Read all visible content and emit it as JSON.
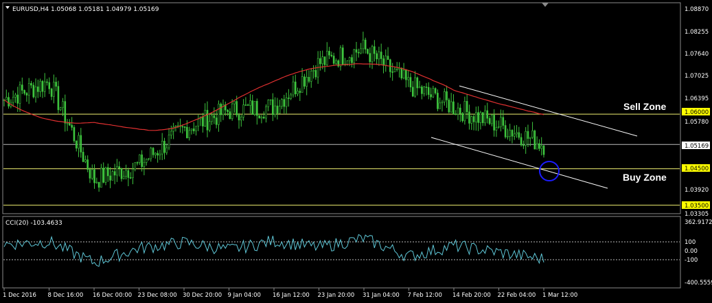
{
  "window": {
    "symbol_header": "EURUSD,H4  1.05068 1.05181 1.04979 1.05169"
  },
  "indicator": {
    "label": "CCI(20) -103.4633",
    "axis_labels": [
      "362.9172",
      "100",
      "0.00",
      "-100",
      "-400.5559"
    ]
  },
  "annotations": {
    "sell_zone": "Sell Zone",
    "buy_zone": "Buy Zone"
  },
  "price_axis": {
    "labels": [
      "1.08870",
      "1.08255",
      "1.07640",
      "1.07025",
      "1.06395",
      "1.05780",
      "1.03920",
      "1.03305"
    ],
    "highlight_levels": [
      "1.06000",
      "1.04500",
      "1.03500"
    ],
    "current_price": "1.05169"
  },
  "time_axis": {
    "labels": [
      "1 Dec 2016",
      "8 Dec 16:00",
      "16 Dec 00:00",
      "23 Dec 08:00",
      "30 Dec 20:00",
      "9 Jan 04:00",
      "16 Jan 12:00",
      "23 Jan 20:00",
      "31 Jan 04:00",
      "7 Feb 12:00",
      "14 Feb 20:00",
      "22 Feb 04:00",
      "1 Mar 12:00"
    ]
  },
  "colors": {
    "background": "#000000",
    "candles": "#3ec63e",
    "moving_average": "#e03030",
    "horizontal_levels": "#f0f070",
    "channel_lines": "#ffffff",
    "cci_line": "#5fc8d8",
    "marker_circle": "#1c1cff",
    "level_label_bg": "#ffff00",
    "frame": "#8a8a8a"
  },
  "chart_data": {
    "type": "line",
    "series": [
      {
        "name": "EURUSD,H4",
        "x": [
          "1 Dec 2016",
          "8 Dec 16:00",
          "16 Dec 00:00",
          "23 Dec 08:00",
          "30 Dec 20:00",
          "9 Jan 04:00",
          "16 Jan 12:00",
          "23 Jan 20:00",
          "31 Jan 04:00",
          "7 Feb 12:00",
          "14 Feb 20:00",
          "22 Feb 04:00",
          "1 Mar 12:00"
        ],
        "values": [
          1.064,
          1.069,
          1.042,
          1.046,
          1.056,
          1.061,
          1.062,
          1.074,
          1.078,
          1.068,
          1.062,
          1.057,
          1.0517
        ]
      },
      {
        "name": "CCI(20)",
        "x": [
          "1 Dec 2016",
          "8 Dec 16:00",
          "16 Dec 00:00",
          "23 Dec 08:00",
          "30 Dec 20:00",
          "9 Jan 04:00",
          "16 Jan 12:00",
          "23 Jan 20:00",
          "31 Jan 04:00",
          "7 Feb 12:00",
          "14 Feb 20:00",
          "22 Feb 04:00",
          "1 Mar 12:00"
        ],
        "values": [
          80,
          110,
          -150,
          30,
          100,
          10,
          120,
          40,
          150,
          -70,
          60,
          -20,
          -103.4633
        ]
      }
    ],
    "price_ylim": [
      1.03305,
      1.0887
    ],
    "cci_ylim": [
      -400.5559,
      362.9172
    ],
    "levels": [
      1.06,
      1.045,
      1.035
    ],
    "grid": false
  }
}
